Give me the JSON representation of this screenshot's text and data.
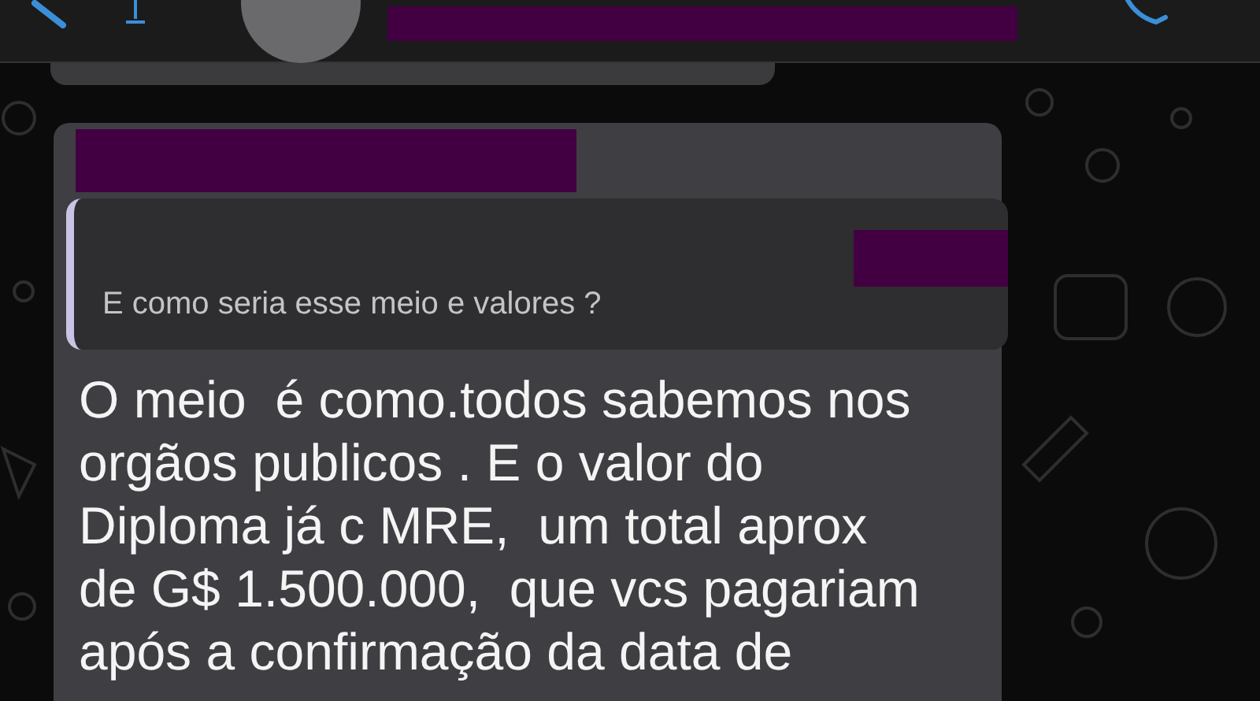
{
  "header": {
    "redacted_name": true
  },
  "quoted_message": {
    "text": "E como seria esse meio e valores ?"
  },
  "message": {
    "lines": [
      "O meio  é como.todos sabemos nos",
      "orgãos publicos . E o valor do",
      "Diploma já c MRE,  um total aprox",
      "de G$ 1.500.000,  que vcs pagariam",
      "após a confirmação da data de"
    ]
  }
}
